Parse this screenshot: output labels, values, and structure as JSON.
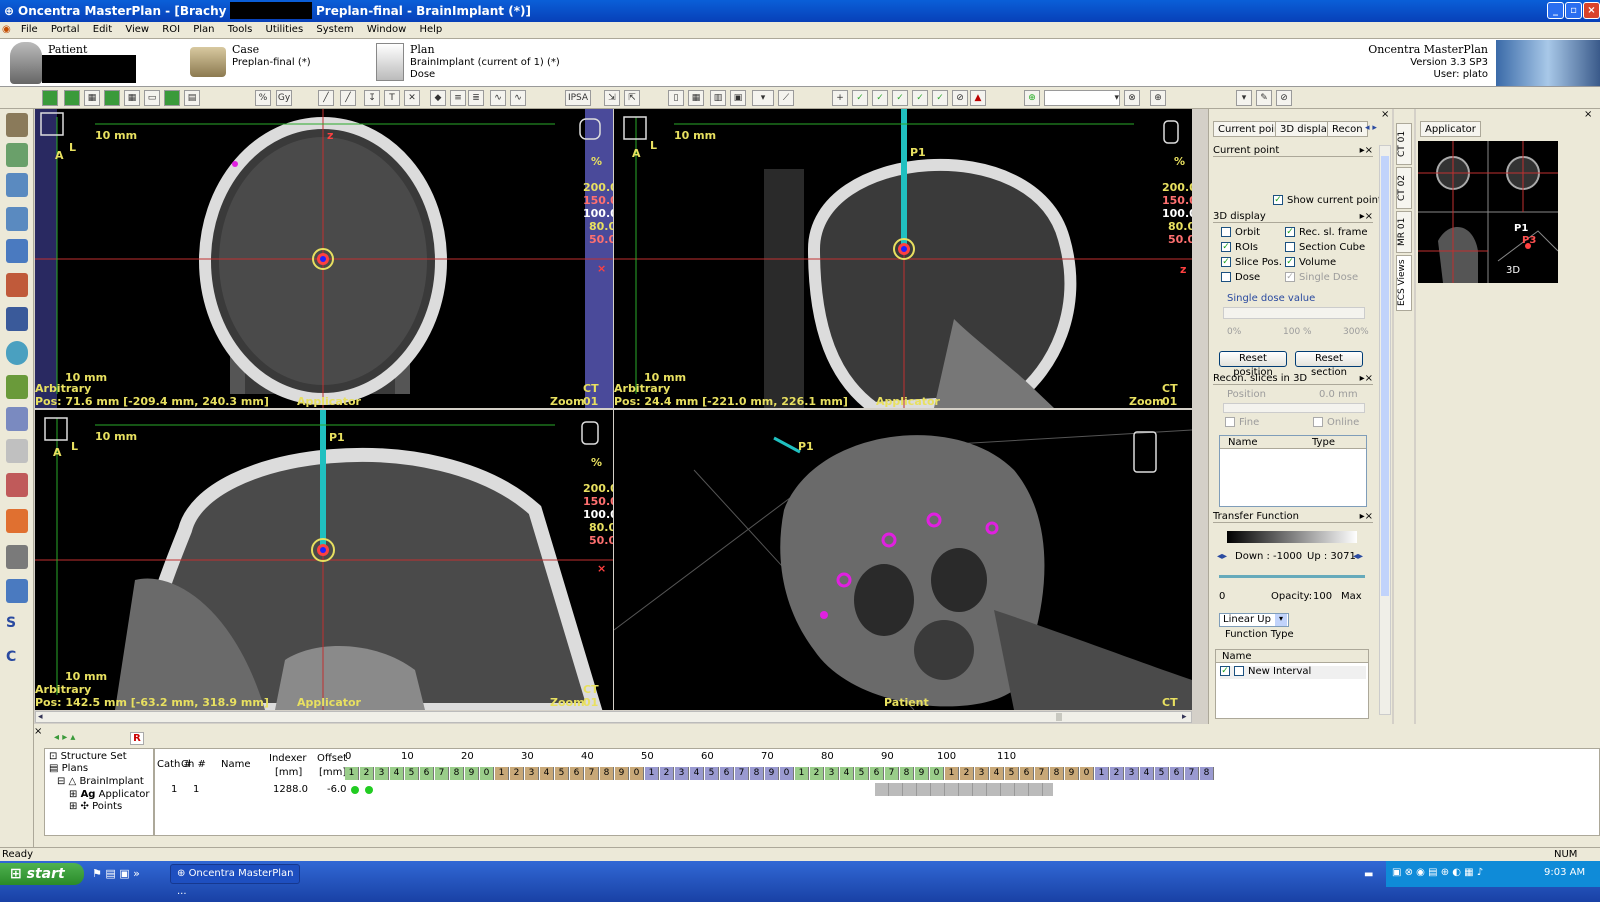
{
  "window": {
    "title_left": "Oncentra MasterPlan - [Brachy Planning",
    "title_right": "Preplan-final - BrainImplant (*)]"
  },
  "menu": [
    "File",
    "Portal",
    "Edit",
    "View",
    "ROI",
    "Plan",
    "Tools",
    "Utilities",
    "System",
    "Window",
    "Help"
  ],
  "info": {
    "patient_label": "Patient",
    "case_label": "Case",
    "case_value": "Preplan-final (*)",
    "plan_label": "Plan",
    "plan_value": "BrainImplant (current of 1) (*)",
    "plan_sub": "Dose",
    "product": "Oncentra MasterPlan",
    "version": "Version 3.3 SP3",
    "user": "User: plato"
  },
  "toolbar": {
    "pct": "%",
    "gy": "Gy",
    "ipsa": "IPSA"
  },
  "viewports": {
    "common": {
      "scale": "10 mm",
      "arbitrary": "Arbitrary",
      "applicator": "Applicator",
      "a": "A",
      "l": "L",
      "pct": "%",
      "dose_200": "200.0",
      "dose_150": "150.0",
      "dose_100": "100.0",
      "dose_80": "80.0",
      "dose_50": "50.0",
      "x_mark": "×",
      "z_mark": "z",
      "p1": "P1",
      "p3": "P3"
    },
    "tl": {
      "ct": "CT 01",
      "pos": "Pos: 71.6 mm [-209.4 mm, 240.3 mm]",
      "zoom": "Zoom 176%"
    },
    "tr": {
      "ct": "CT 01",
      "pos": "Pos: 24.4 mm [-221.0 mm, 226.1 mm]",
      "zoom": "Zoom 193%"
    },
    "bl": {
      "ct": "CT 01",
      "pos": "Pos: 142.5 mm [-63.2 mm, 318.9 mm]",
      "zoom": "Zoom 262%"
    },
    "br": {
      "ct": "CT 01",
      "label": "Patient"
    }
  },
  "right_panel": {
    "tabs": [
      "Current point",
      "3D display",
      "Recon"
    ],
    "current_point_title": "Current point",
    "show_current_point": "Show current point",
    "display_title": "3D display",
    "checks_left": [
      {
        "label": "Orbit",
        "checked": false
      },
      {
        "label": "ROIs",
        "checked": true
      },
      {
        "label": "Slice Pos.",
        "checked": true
      },
      {
        "label": "Dose",
        "checked": false
      }
    ],
    "checks_right": [
      {
        "label": "Rec. sl. frame",
        "checked": true
      },
      {
        "label": "Section Cube",
        "checked": false
      },
      {
        "label": "Volume",
        "checked": true
      },
      {
        "label": "Single Dose",
        "checked": true
      }
    ],
    "single_dose_value": "Single dose value",
    "slider_min": "0%",
    "slider_mid": "100 %",
    "slider_max": "300%",
    "reset_position": "Reset position",
    "reset_section": "Reset section",
    "recon_title": "Recon. slices in 3D",
    "position_label": "Position",
    "position_value": "0.0 mm",
    "fine": "Fine",
    "online": "Online",
    "col_name": "Name",
    "col_type": "Type",
    "transfer_title": "Transfer Function",
    "down_label": "Down : -1000",
    "up_label": "Up : 3071",
    "opacity_min": "0",
    "opacity_label": "Opacity:",
    "opacity_value": "100",
    "opacity_max": "Max",
    "function_select": "Linear Up",
    "function_type": "Function Type",
    "interval_col": "Name",
    "interval_item": "New Interval"
  },
  "side_tabs": [
    "CT 01",
    "CT 02",
    "MR 01",
    "ECS Views"
  ],
  "applicator_panel": {
    "title": "Applicator",
    "p1": "P1",
    "p3": "P3",
    "label_3d": "3D"
  },
  "tree": {
    "items": [
      "Structure Set",
      "Plans",
      "BrainImplant",
      "Applicator",
      "Points"
    ]
  },
  "catheter_table": {
    "headers": [
      "Cath #",
      "Ch #",
      "Name",
      "Indexer",
      "Offset"
    ],
    "units": [
      "[mm]",
      "[mm]"
    ],
    "row": {
      "cath": "1",
      "ch": "1",
      "indexer": "1288.0",
      "offset": "-6.0"
    },
    "ruler": [
      "0",
      "10",
      "20",
      "30",
      "40",
      "50",
      "60",
      "70",
      "80",
      "90",
      "100",
      "110"
    ],
    "digits": [
      "1",
      "2",
      "3",
      "4",
      "5",
      "6",
      "7",
      "8",
      "9",
      "0",
      "1",
      "2",
      "3",
      "4",
      "5",
      "6",
      "7",
      "8",
      "9",
      "0",
      "1",
      "2",
      "3",
      "4",
      "5",
      "6",
      "7",
      "8",
      "9",
      "0",
      "1",
      "2",
      "3",
      "4",
      "5",
      "6",
      "7",
      "8",
      "9",
      "0",
      "1",
      "2",
      "3",
      "4",
      "5",
      "6",
      "7",
      "8",
      "9",
      "0",
      "1",
      "2",
      "3",
      "4",
      "5",
      "6",
      "7",
      "8"
    ]
  },
  "status": {
    "left": "Ready",
    "right": "NUM"
  },
  "taskbar": {
    "start": "start",
    "task": "Oncentra MasterPlan ...",
    "time": "9:03 AM"
  },
  "colors": {
    "accent": "#0a5fd8",
    "dose_yellow": "#e8e060",
    "dose_red": "#ff7070",
    "green_line": "#3ad23a",
    "cyan": "#20c0c0",
    "magenta": "#e020e0"
  }
}
